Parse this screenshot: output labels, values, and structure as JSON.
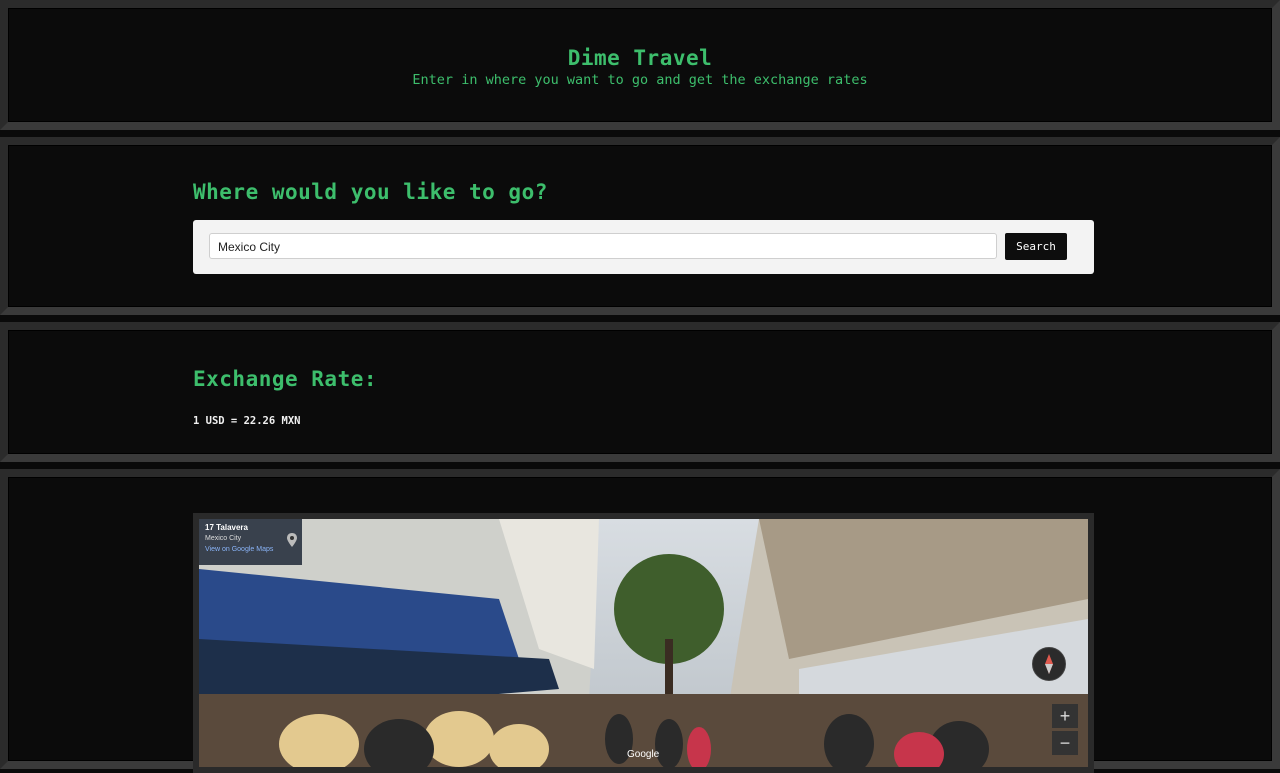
{
  "header": {
    "title": "Dime Travel",
    "subtitle": "Enter in where you want to go and get the exchange rates"
  },
  "search": {
    "heading": "Where would you like to go?",
    "value": "Mexico City",
    "button_label": "Search"
  },
  "exchange": {
    "heading": "Exchange Rate:",
    "rate_text": "1 USD = 22.26 MXN"
  },
  "streetview": {
    "place_name": "17 Talavera",
    "city": "Mexico City",
    "link_text": "View on Google Maps",
    "zoom_in_label": "+",
    "zoom_out_label": "−",
    "attribution": "Google"
  },
  "colors": {
    "accent_green": "#3dbe6c",
    "panel_bg": "#0b0b0b",
    "button_bg": "#0d0d0d"
  }
}
